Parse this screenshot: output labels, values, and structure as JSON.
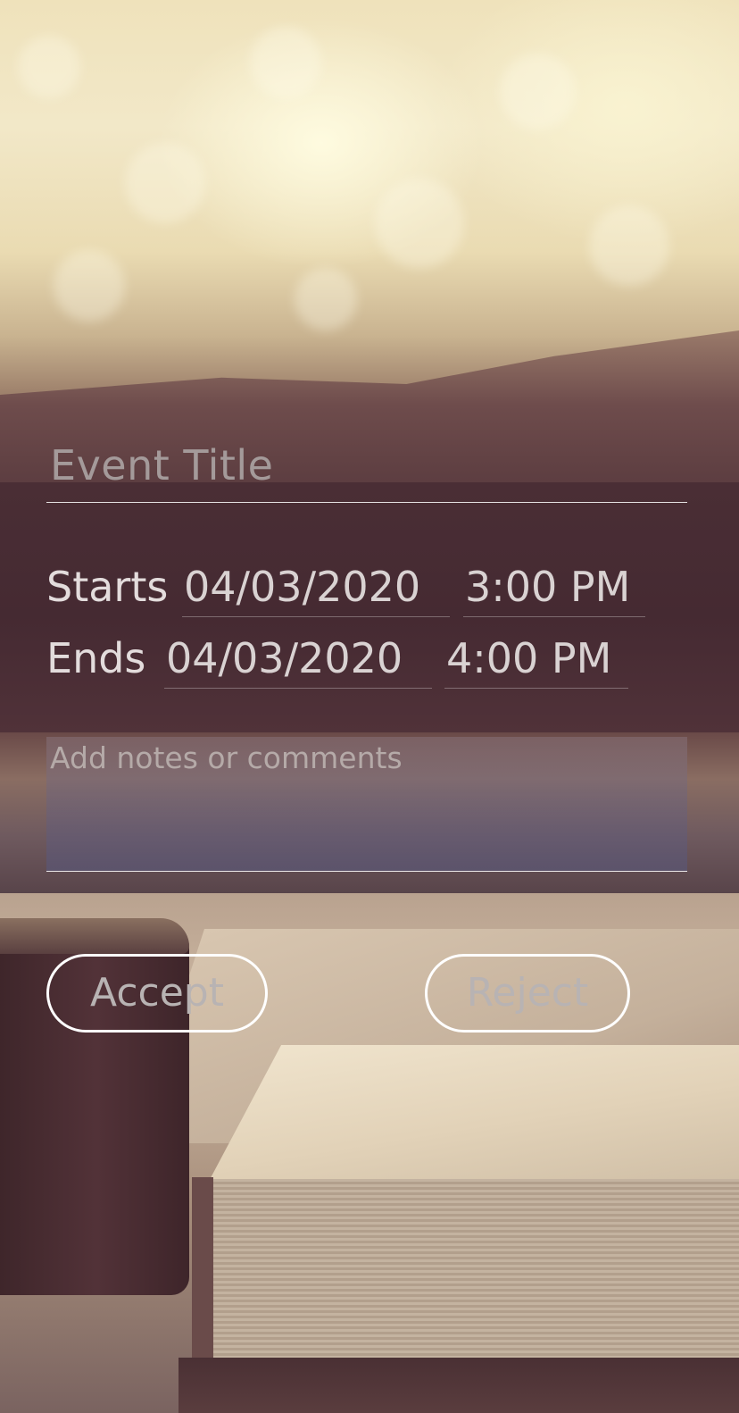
{
  "event": {
    "title_placeholder": "Event Title",
    "start": {
      "label": "Starts",
      "date": "04/03/2020",
      "time": "3:00 PM"
    },
    "end": {
      "label": "Ends",
      "date": "04/03/2020",
      "time": "4:00 PM"
    },
    "notes_placeholder": "Add notes or comments"
  },
  "actions": {
    "accept_label": "Accept",
    "reject_label": "Reject"
  },
  "colors": {
    "button_border": "#ffffff",
    "text_primary": "#e3dcdc",
    "placeholder": "#a49a9a"
  }
}
